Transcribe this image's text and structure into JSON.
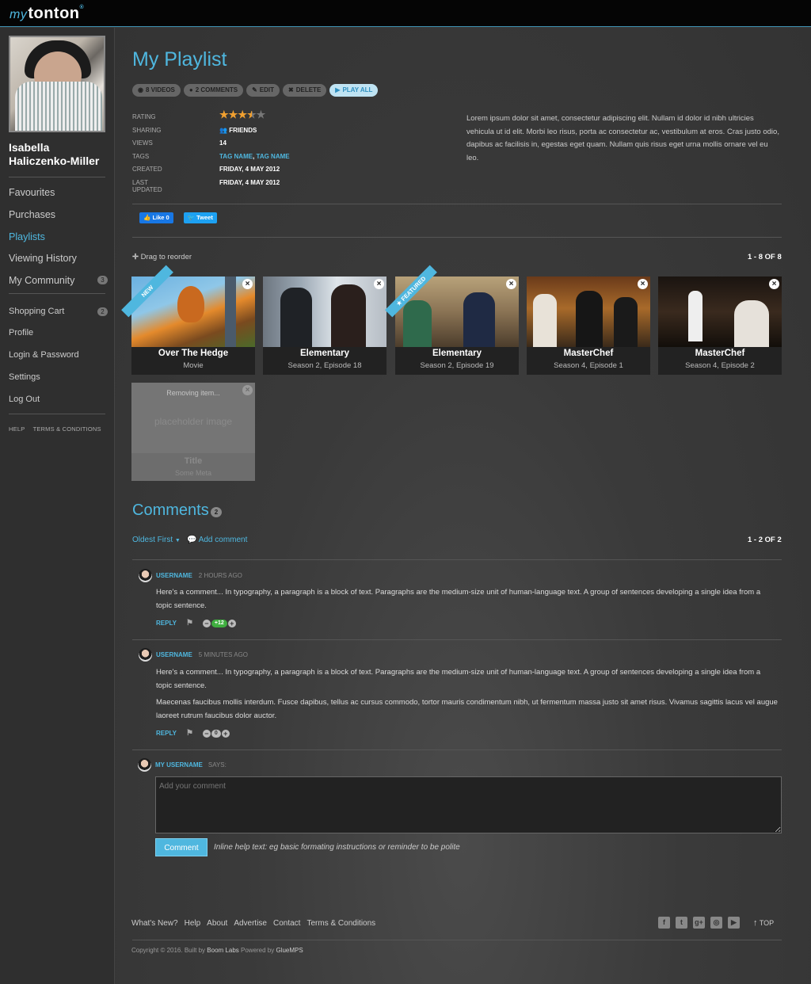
{
  "brand": {
    "prefix": "my",
    "name": "tonton",
    "reg": "®"
  },
  "user": {
    "name": "Isabella Haliczenko-Miller"
  },
  "sidebar": {
    "main_items": [
      {
        "label": "Favourites"
      },
      {
        "label": "Purchases"
      },
      {
        "label": "Playlists"
      },
      {
        "label": "Viewing History"
      },
      {
        "label": "My Community",
        "badge": "3"
      }
    ],
    "account_items": [
      {
        "label": "Shopping Cart",
        "badge": "2"
      },
      {
        "label": "Profile"
      },
      {
        "label": "Login & Password"
      },
      {
        "label": "Settings"
      },
      {
        "label": "Log Out"
      }
    ],
    "footer": {
      "help": "HELP",
      "terms": "TERMS & CONDITIONS"
    }
  },
  "playlist": {
    "title": "My Playlist",
    "pills": {
      "videos": "8 VIDEOS",
      "comments": "2 COMMENTS",
      "edit": "EDIT",
      "delete": "DELETE",
      "play": "PLAY ALL"
    },
    "meta": {
      "rating_label": "RATING",
      "rating": 3.5,
      "rating_max": 5,
      "sharing_label": "SHARING",
      "sharing": "FRIENDS",
      "views_label": "VIEWS",
      "views": "14",
      "tags_label": "TAGS",
      "tag1": "TAG NAME",
      "tag_sep": ", ",
      "tag2": "TAG NAME",
      "created_label": "CREATED",
      "created": "FRIDAY, 4 MAY 2012",
      "updated_label": "LAST UPDATED",
      "updated": "FRIDAY, 4 MAY 2012"
    },
    "description": "Lorem ipsum dolor sit amet, consectetur adipiscing elit. Nullam id dolor id nibh ultricies vehicula ut id elit. Morbi leo risus, porta ac consectetur ac, vestibulum at eros. Cras justo odio, dapibus ac facilisis in, egestas eget quam. Nullam quis risus eget urna mollis ornare vel eu leo.",
    "social": {
      "like": "Like 0",
      "tweet": "Tweet"
    },
    "drag_hint": "Drag to reorder",
    "count": "1 - 8 OF 8",
    "videos": [
      {
        "title": "Over The Hedge",
        "meta": "Movie",
        "ribbon": "NEW"
      },
      {
        "title": "Elementary",
        "meta": "Season 2, Episode 18"
      },
      {
        "title": "Elementary",
        "meta": "Season 2, Episode 19",
        "ribbon": "★ FEATURED"
      },
      {
        "title": "MasterChef",
        "meta": "Season 4, Episode 1"
      },
      {
        "title": "MasterChef",
        "meta": "Season 4, Episode 2"
      }
    ],
    "removing": {
      "status": "Removing item...",
      "placeholder": "placeholder image",
      "title": "Title",
      "meta": "Some Meta"
    }
  },
  "comments": {
    "title": "Comments",
    "count_badge": "2",
    "sort": "Oldest First",
    "add": "Add comment",
    "range": "1 - 2 OF 2",
    "items": [
      {
        "user": "USERNAME",
        "ago": "2 HOURS AGO",
        "paragraphs": [
          "Here's a comment... In typography, a paragraph is a block of text. Paragraphs are the medium-size unit of human-language text. A group of sentences developing a single idea from a topic sentence."
        ],
        "reply": "REPLY",
        "votes": "+12"
      },
      {
        "user": "USERNAME",
        "ago": "5 MINUTES AGO",
        "paragraphs": [
          "Here's a comment... In typography, a paragraph is a block of text. Paragraphs are the medium-size unit of human-language text. A group of sentences developing a single idea from a topic sentence.",
          "Maecenas faucibus mollis interdum. Fusce dapibus, tellus ac cursus commodo, tortor mauris condimentum nibh, ut fermentum massa justo sit amet risus. Vivamus sagittis lacus vel augue laoreet rutrum faucibus dolor auctor."
        ],
        "reply": "REPLY",
        "votes": "0"
      }
    ],
    "compose": {
      "user": "MY USERNAME",
      "says": "SAYS:",
      "placeholder": "Add your comment",
      "button": "Comment",
      "help": "Inline help text: eg basic formating instructions or reminder to be polite"
    }
  },
  "footer": {
    "links": [
      "What's New?",
      "Help",
      "About",
      "Advertise",
      "Contact",
      "Terms & Conditions"
    ],
    "social_icons": [
      "facebook-icon",
      "twitter-icon",
      "google-plus-icon",
      "instagram-icon",
      "youtube-icon"
    ],
    "top": "TOP",
    "copyright": "Copyright © 2016. Built by",
    "builder": "Boom Labs",
    "powered": "Powered by",
    "platform": "GlueMPS"
  },
  "colors": {
    "accent": "#4fb7df",
    "vote_positive": "#3fae3f"
  }
}
